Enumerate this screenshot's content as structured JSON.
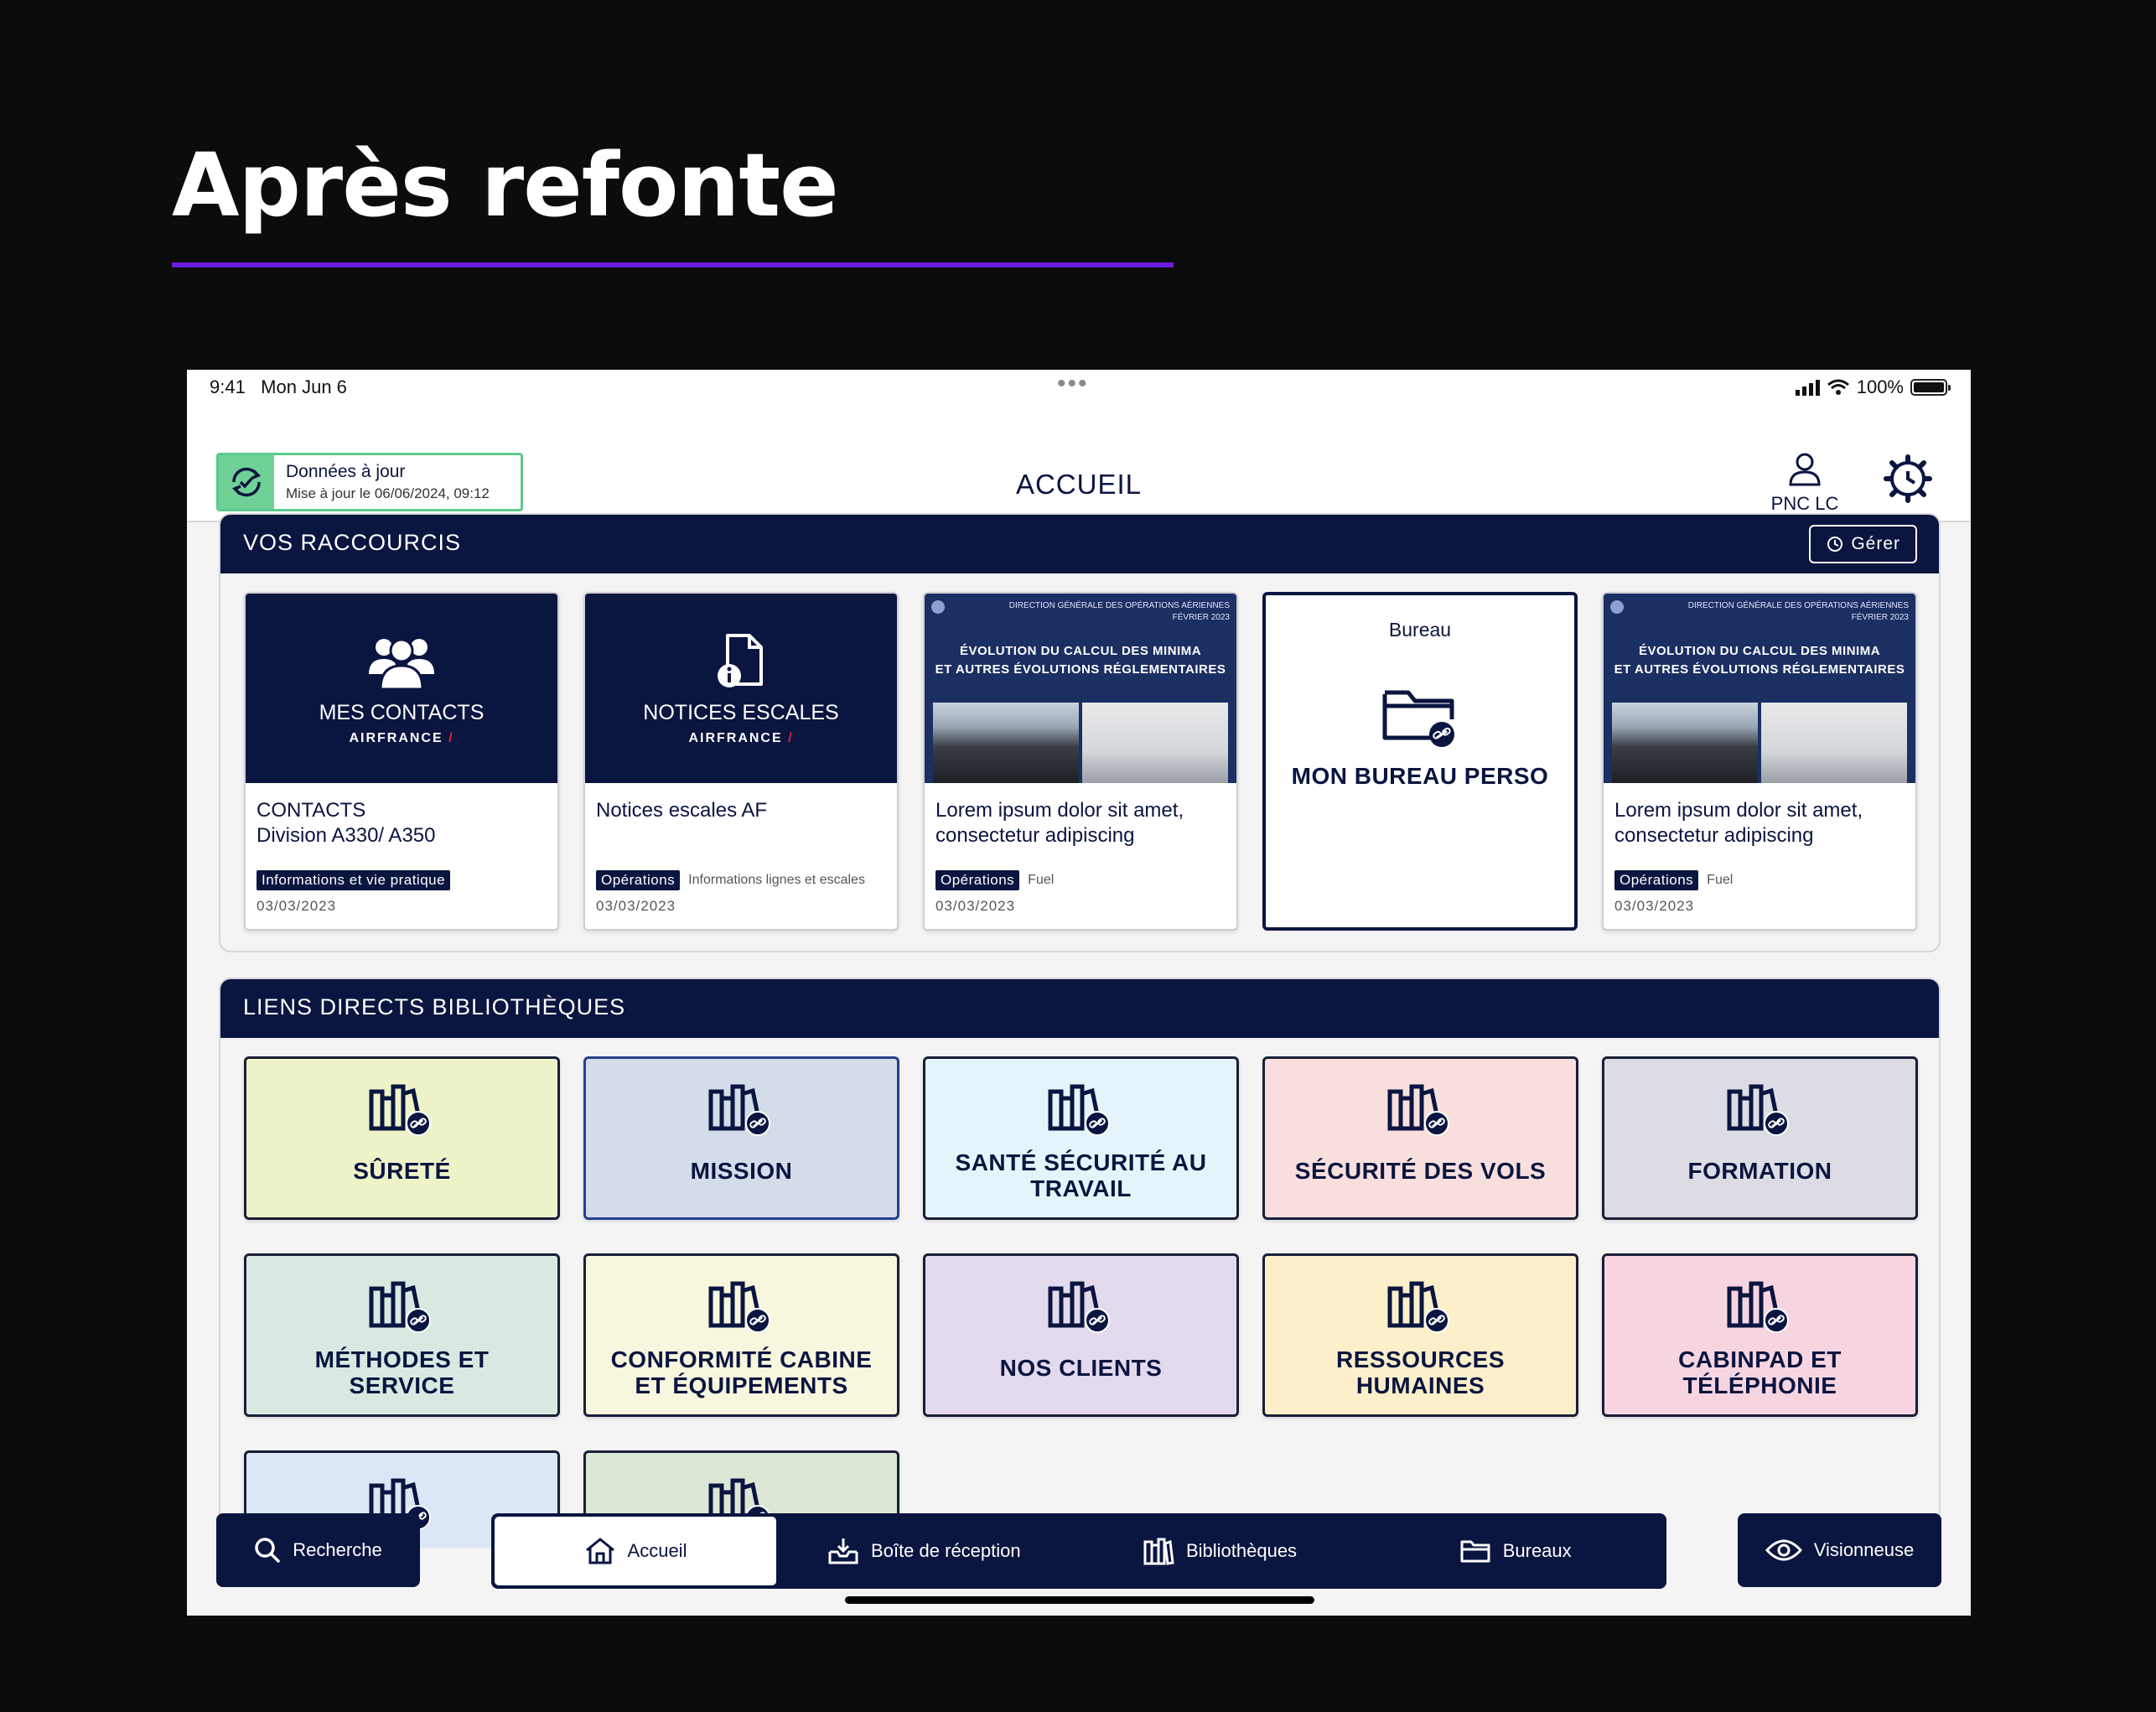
{
  "slide": {
    "title": "Après refonte"
  },
  "statusbar": {
    "time": "9:41",
    "date": "Mon Jun 6",
    "dots": "•••",
    "battery": "100%"
  },
  "sync": {
    "title": "Données à jour",
    "subtitle": "Mise à jour le 06/06/2024, 09:12"
  },
  "header": {
    "title": "ACCUEIL",
    "user_label": "PNC LC"
  },
  "shortcuts": {
    "title": "VOS RACCOURCIS",
    "manage_label": "Gérer",
    "cards": [
      {
        "label": "MES CONTACTS",
        "brand": "AIRFRANCE",
        "line1": "CONTACTS",
        "line2": "Division A330/ A350",
        "tag": "Informations et vie pratique",
        "subtag": "",
        "date": "03/03/2023",
        "icon": "contacts-icon"
      },
      {
        "label": "NOTICES ESCALES",
        "brand": "AIRFRANCE",
        "line1": "Notices escales AF",
        "line2": "",
        "tag": "Opérations",
        "subtag": "Informations lignes et escales",
        "date": "03/03/2023",
        "icon": "document-info-icon"
      },
      {
        "doc_header": "DIRECTION GÉNÉRALE DES OPÉRATIONS AÉRIENNES",
        "doc_sub": "FÉVRIER 2023",
        "doc_title1": "ÉVOLUTION DU CALCUL DES MINIMA",
        "doc_title2": "ET AUTRES ÉVOLUTIONS RÉGLEMENTAIRES",
        "line1": "Lorem ipsum dolor sit amet,",
        "line2": "consectetur adipiscing",
        "tag": "Opérations",
        "subtag": "Fuel",
        "date": "03/03/2023"
      },
      {
        "caption": "Bureau",
        "label": "MON BUREAU PERSO",
        "icon": "folder-link-icon"
      },
      {
        "doc_header": "DIRECTION GÉNÉRALE DES OPÉRATIONS AÉRIENNES",
        "doc_sub": "FÉVRIER 2023",
        "doc_title1": "ÉVOLUTION DU CALCUL DES MINIMA",
        "doc_title2": "ET AUTRES ÉVOLUTIONS RÉGLEMENTAIRES",
        "line1": "Lorem ipsum dolor sit amet,",
        "line2": "consectetur adipiscing",
        "tag": "Opérations",
        "subtag": "Fuel",
        "date": "03/03/2023"
      }
    ]
  },
  "libraries": {
    "title": "LIENS DIRECTS BIBLIOTHÈQUES",
    "items": [
      {
        "line1": "SÛRETÉ",
        "line2": "",
        "color": "#eef4c8"
      },
      {
        "line1": "MISSION",
        "line2": "",
        "color": "#d4dcea"
      },
      {
        "line1": "SANTÉ SÉCURITÉ AU",
        "line2": "TRAVAIL",
        "color": "#e5f4fa"
      },
      {
        "line1": "SÉCURITÉ DES VOLS",
        "line2": "",
        "color": "#f8dfdd"
      },
      {
        "line1": "FORMATION",
        "line2": "",
        "color": "#dcdde4"
      },
      {
        "line1": "MÉTHODES ET",
        "line2": "SERVICE",
        "color": "#d9e9e2"
      },
      {
        "line1": "CONFORMITÉ CABINE",
        "line2": "ET ÉQUIPEMENTS",
        "color": "#f8f6dd"
      },
      {
        "line1": "NOS CLIENTS",
        "line2": "",
        "color": "#e4daed"
      },
      {
        "line1": "RESSOURCES",
        "line2": "HUMAINES",
        "color": "#fdefc9"
      },
      {
        "line1": "CABINPAD ET",
        "line2": "TÉLÉPHONIE",
        "color": "#f7d5e0"
      },
      {
        "line1": "",
        "line2": "",
        "color": "#dde6f7"
      },
      {
        "line1": "",
        "line2": "",
        "color": "#dde7d6"
      }
    ]
  },
  "bottomnav": {
    "search": "Recherche",
    "tabs": [
      "Accueil",
      "Boîte de réception",
      "Bibliothèques",
      "Bureaux"
    ],
    "viewer": "Visionneuse"
  }
}
